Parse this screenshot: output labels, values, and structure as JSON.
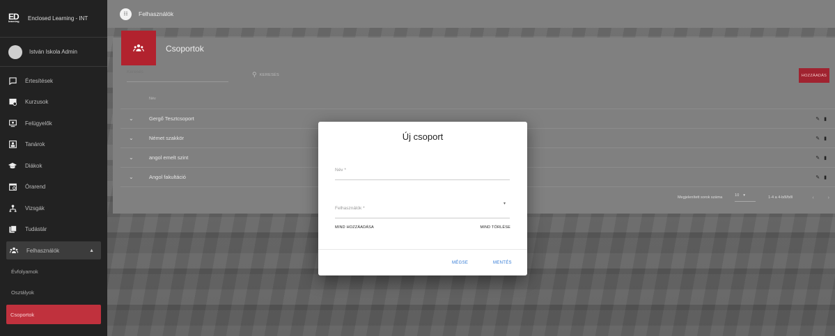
{
  "sidebar": {
    "brand": "Enclosed Learning - INT",
    "logo_text": "ED",
    "logo_sub": "learning",
    "user_name": "István Iskola Admin",
    "items": [
      {
        "label": "Értesítések",
        "icon": "chat-icon"
      },
      {
        "label": "Kurzusok",
        "icon": "courses-icon"
      },
      {
        "label": "Felügyelők",
        "icon": "monitor-icon"
      },
      {
        "label": "Tanárok",
        "icon": "teacher-icon"
      },
      {
        "label": "Diákok",
        "icon": "graduation-cap-icon"
      },
      {
        "label": "Órarend",
        "icon": "calendar-icon"
      },
      {
        "label": "Vizsgák",
        "icon": "exam-icon"
      },
      {
        "label": "Tudástár",
        "icon": "library-icon"
      },
      {
        "label": "Felhasználók",
        "icon": "users-icon"
      }
    ],
    "subitems": [
      "Évfolyamok",
      "Osztályok",
      "Csoportok"
    ]
  },
  "topbar": {
    "title": "Felhasználók"
  },
  "panel": {
    "title": "Csoportok",
    "search_placeholder": "Keresés",
    "search_button": "KERESÉS",
    "add_button": "HOZZÁADÁS",
    "column_name": "Név",
    "rows": [
      "Gergő Tesztcsoport",
      "Német szakkör",
      "angol emelt szint",
      "Angol fakultáció"
    ],
    "pager_label": "Megjelenített sorok száma",
    "pager_size": "10",
    "pager_range": "1-4 a 4-ből/ből"
  },
  "dialog": {
    "title": "Új csoport",
    "name_label": "Név *",
    "users_label": "Felhasználók *",
    "add_all": "MIND HOZZÁADÁSA",
    "remove_all": "MIND TÖRLÉSE",
    "cancel": "MÉGSE",
    "save": "MENTÉS"
  },
  "colors": {
    "accent": "#b2222e",
    "link": "#2f78d4",
    "sidebar_bg": "#222222"
  }
}
